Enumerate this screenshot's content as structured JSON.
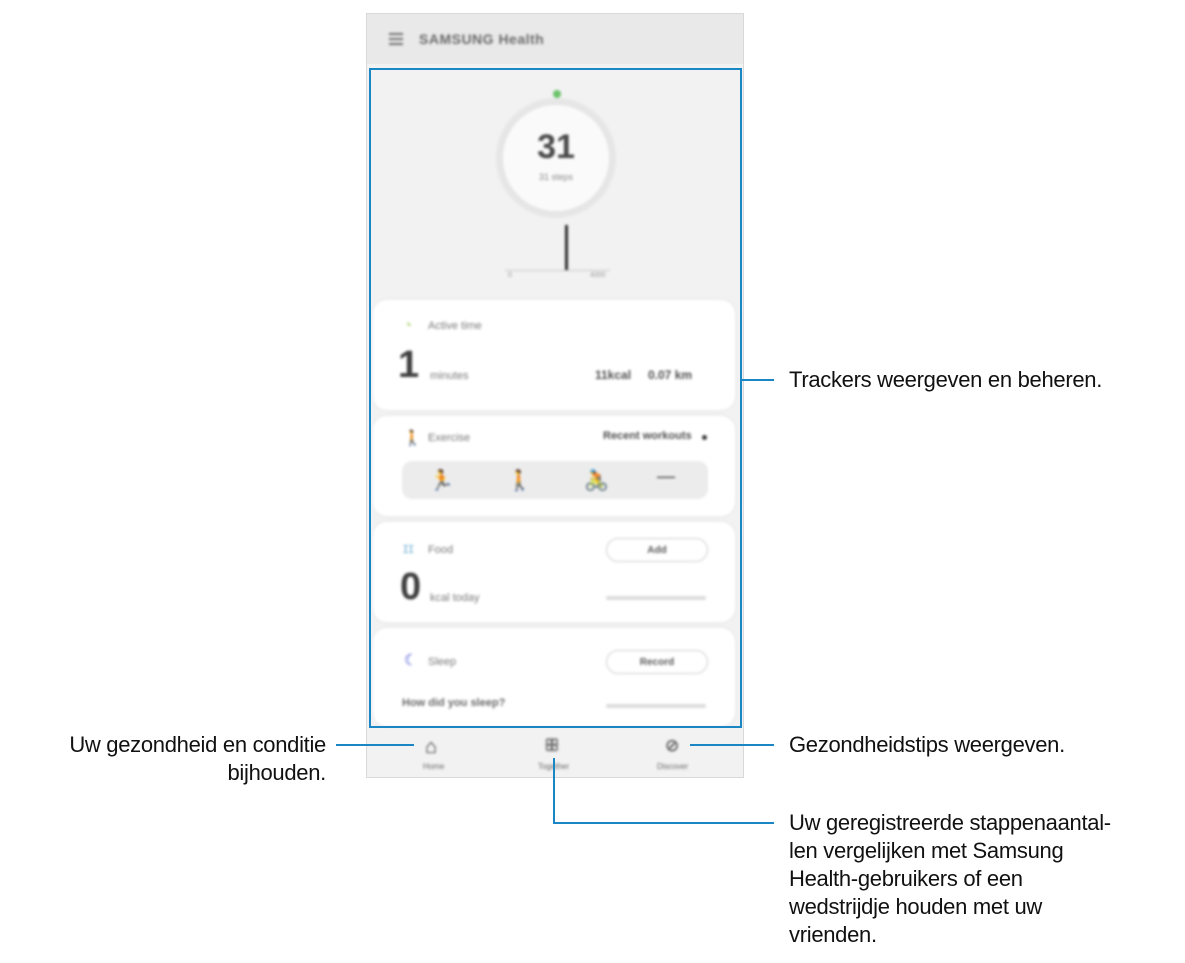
{
  "app": {
    "title": "SAMSUNG Health",
    "menu_icon": "menu-icon"
  },
  "steps": {
    "value": "31",
    "label": "31 steps",
    "graph_min": "0",
    "graph_max": "4000"
  },
  "activity": {
    "icon": "timer-icon",
    "label": "Active time",
    "value": "1",
    "unit": "minutes",
    "kcal": "11kcal",
    "distance": "0.07 km"
  },
  "exercise": {
    "icon": "walker-icon",
    "label": "Exercise",
    "action": "Recent workouts",
    "items": [
      {
        "icon": "running-icon",
        "glyph": "🏃"
      },
      {
        "icon": "walking-icon",
        "glyph": "🚶"
      },
      {
        "icon": "cycling-icon",
        "glyph": "🚴"
      },
      {
        "icon": "more-icon",
        "glyph": "—"
      }
    ]
  },
  "food": {
    "icon": "utensils-icon",
    "label": "Food",
    "button": "Add",
    "value": "0",
    "unit": "kcal today"
  },
  "sleep": {
    "icon": "moon-icon",
    "label": "Sleep",
    "button": "Record",
    "question": "How did you sleep?"
  },
  "nav": {
    "items": [
      {
        "icon": "home-icon",
        "glyph": "⌂",
        "label": "Home"
      },
      {
        "icon": "together-icon",
        "glyph": "ꕥ",
        "label": "Together"
      },
      {
        "icon": "discover-icon",
        "glyph": "⊘",
        "label": "Discover"
      }
    ]
  },
  "annotations": {
    "trackers": "Trackers weergeven en beheren.",
    "home_line1": "Uw gezondheid en conditie",
    "home_line2": "bijhouden.",
    "discover": "Gezondheidstips weergeven.",
    "together_line1": "Uw geregistreerde stappenaantal-",
    "together_line2": "len vergelijken met Samsung",
    "together_line3": "Health-gebruikers of een",
    "together_line4": "wedstrijdje houden met uw",
    "together_line5": "vrienden."
  },
  "colors": {
    "highlight": "#1b86c4",
    "ring_dot": "#6cc36c",
    "activity_icon": "#b5d77a",
    "exercise_icon": "#8fcf6a",
    "food_icon": "#7fb8d9",
    "sleep_icon": "#3d4bd0"
  }
}
